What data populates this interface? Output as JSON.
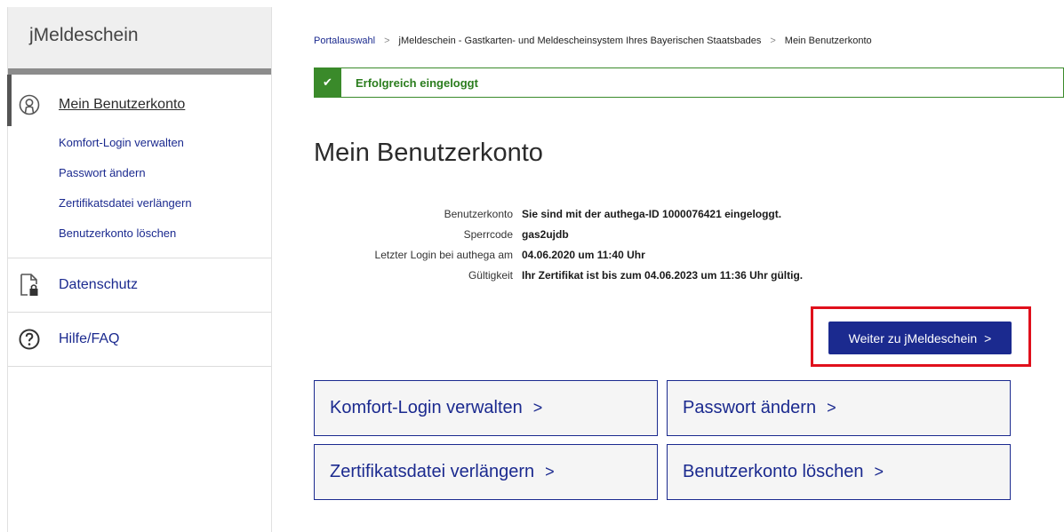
{
  "sidebar": {
    "title": "jMeldeschein",
    "main_item": {
      "label": "Mein Benutzerkonto",
      "icon": "user-circle-icon",
      "subitems": [
        "Komfort-Login verwalten",
        "Passwort ändern",
        "Zertifikatsdatei verlängern",
        "Benutzerkonto löschen"
      ]
    },
    "privacy": {
      "label": "Datenschutz",
      "icon": "document-lock-icon"
    },
    "help": {
      "label": "Hilfe/FAQ",
      "icon": "question-circle-icon"
    }
  },
  "breadcrumb": {
    "items": [
      "Portalauswahl",
      "jMeldeschein - Gastkarten- und Meldescheinsystem Ihres Bayerischen Staatsbades",
      "Mein Benutzerkonto"
    ],
    "separator": ">"
  },
  "alert": {
    "icon": "check-icon",
    "message": "Erfolgreich eingeloggt"
  },
  "page_title": "Mein Benutzerkonto",
  "info": [
    {
      "label": "Benutzerkonto",
      "value": "Sie sind mit der authega-ID 1000076421 eingeloggt."
    },
    {
      "label": "Sperrcode",
      "value": "gas2ujdb"
    },
    {
      "label": "Letzter Login bei authega am",
      "value": "04.06.2020 um 11:40 Uhr"
    },
    {
      "label": "Gültigkeit",
      "value": "Ihr Zertifikat ist bis zum 04.06.2023 um 11:36 Uhr gültig."
    }
  ],
  "primary_button": {
    "label": "Weiter zu jMeldeschein",
    "chevron": ">"
  },
  "tiles": [
    {
      "label": "Komfort-Login verwalten",
      "chevron": ">"
    },
    {
      "label": "Passwort ändern",
      "chevron": ">"
    },
    {
      "label": "Zertifikatsdatei verlängern",
      "chevron": ">"
    },
    {
      "label": "Benutzerkonto löschen",
      "chevron": ">"
    }
  ],
  "colors": {
    "brand": "#1b2a8f",
    "success": "#3a8a2a",
    "highlight": "#e0101c"
  }
}
